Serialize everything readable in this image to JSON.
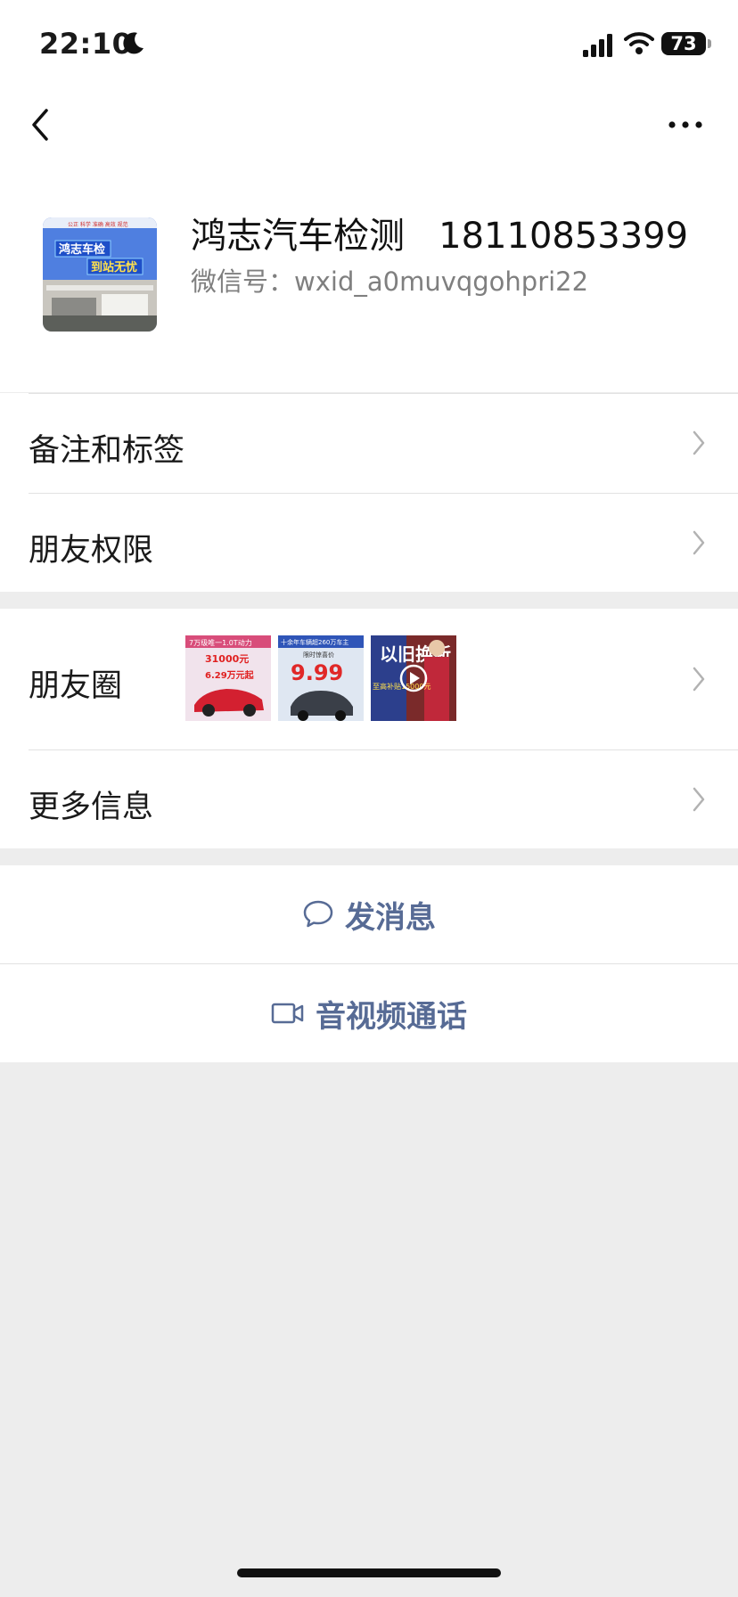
{
  "status_bar": {
    "time": "22:10",
    "battery": "73"
  },
  "profile": {
    "nickname": "鸿志汽车检测   18110853399",
    "wechat_id": "微信号：wxid_a0muvqgohpri22",
    "avatar": {
      "top_text": "公正 科学 准确 高效 规范",
      "title1": "鸿志车检",
      "title2": "到站无忧"
    }
  },
  "rows": {
    "remark_tags": "备注和标签",
    "friend_permissions": "朋友权限",
    "moments": "朋友圈",
    "more_info": "更多信息"
  },
  "moments_thumbs": [
    {
      "top": "7万级唯一1.0T动力",
      "price": "31000元",
      "sub": "6.29万元起"
    },
    {
      "top": "十余年车辆超260万车主",
      "price": "9.99",
      "sub": "限时惊喜价"
    },
    {
      "top": "以旧换新",
      "big": "以旧换新",
      "sub": "至高补贴15000元"
    }
  ],
  "actions": {
    "send_message": "发消息",
    "video_call": "音视频通话"
  },
  "colors": {
    "link": "#576b95",
    "page_bg": "#ededed"
  }
}
